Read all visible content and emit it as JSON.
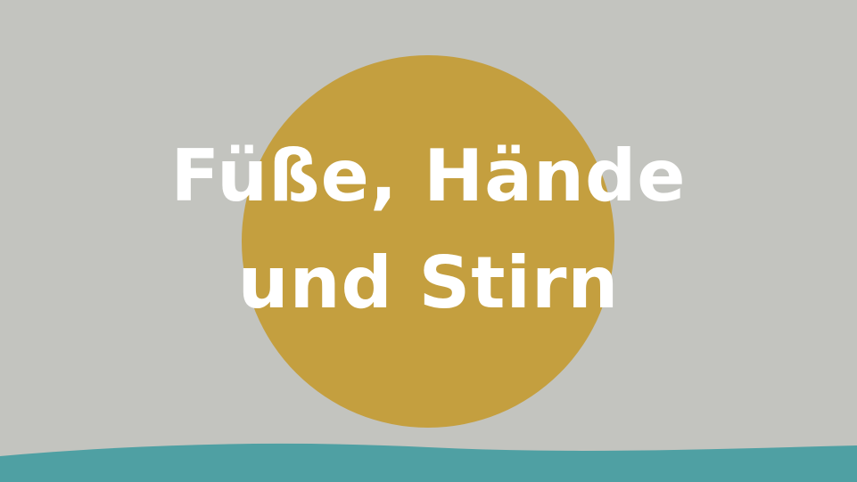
{
  "colors": {
    "background": "#c3c4bf",
    "sun": "#c49f3f",
    "wave": "#4fa0a3",
    "text": "#ffffff"
  },
  "title": {
    "line1": "Füße, Hände",
    "line2": "und Stirn"
  }
}
